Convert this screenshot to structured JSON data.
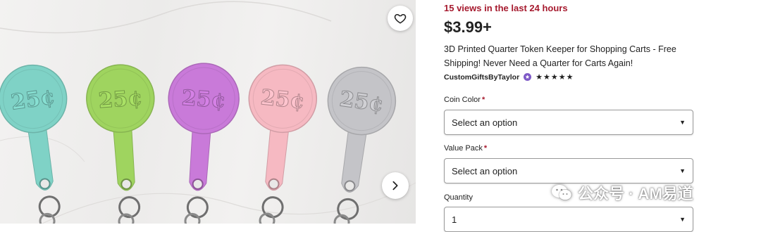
{
  "gallery": {
    "image_alt": "Pastel 3D printed quarter token keepers with 25¢ engraving on keychains",
    "token_text": "25¢",
    "token_colors": [
      "#7fd2c6",
      "#9fd45f",
      "#c97ad9",
      "#f6b9c2",
      "#c4c4c8"
    ],
    "favorite_icon": "heart-outline-icon",
    "next_icon": "chevron-right-icon"
  },
  "listing": {
    "views": "15 views in the last 24 hours",
    "price": "$3.99+",
    "title": "3D Printed Quarter Token Keeper for Shopping Carts - Free Shipping! Never Need a Quarter for Carts Again!",
    "shop_name": "CustomGiftsByTaylor",
    "star_seller_icon": "star-seller-badge-icon",
    "rating_stars": "★★★★★"
  },
  "options": {
    "coin_color": {
      "label": "Coin Color",
      "required_mark": "*",
      "value": "Select an option"
    },
    "value_pack": {
      "label": "Value Pack",
      "required_mark": "*",
      "value": "Select an option"
    },
    "quantity": {
      "label": "Quantity",
      "value": "1"
    }
  },
  "watermark": {
    "text": "公众号 · AM易道",
    "icon": "wechat-icon"
  },
  "colors": {
    "accent_red": "#a61a2e",
    "star_seller_purple": "#7f5ac7"
  }
}
